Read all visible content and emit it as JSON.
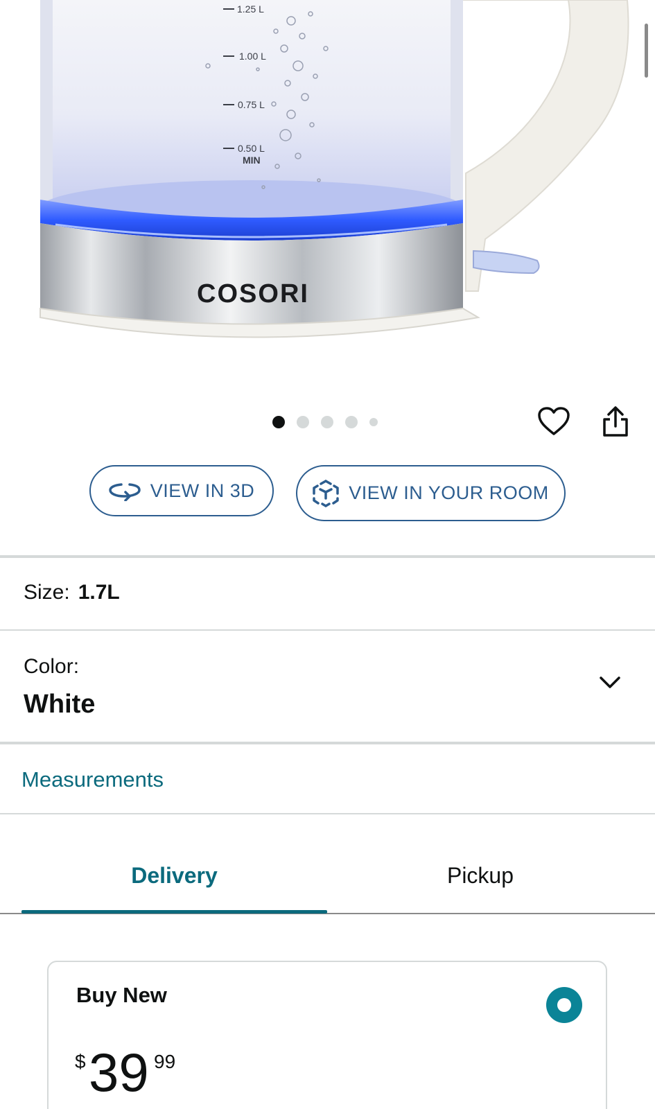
{
  "product_image": {
    "brand": "COSORI",
    "gauge_marks": [
      "1.25 L",
      "1.00 L",
      "0.75 L",
      "0.50 L",
      "MIN"
    ]
  },
  "carousel": {
    "count": 5,
    "active_index": 0
  },
  "actions": {
    "view_3d_label": "VIEW IN 3D",
    "view_room_label": "VIEW IN YOUR ROOM"
  },
  "options": {
    "size_label": "Size:",
    "size_value": "1.7L",
    "color_label": "Color:",
    "color_value": "White"
  },
  "links": {
    "measurements": "Measurements"
  },
  "tabs": [
    {
      "label": "Delivery",
      "selected": true
    },
    {
      "label": "Pickup",
      "selected": false
    }
  ],
  "buy_box": {
    "title": "Buy New",
    "currency_symbol": "$",
    "price_whole": "39",
    "price_fraction": "99",
    "selected": true
  },
  "colors": {
    "link_teal": "#0b6a7d",
    "button_blue": "#2c5d8f",
    "radio_teal": "#0b8497",
    "glow_blue": "#2f5bff"
  },
  "icons": [
    "heart-icon",
    "share-icon",
    "rotate-3d-icon",
    "ar-cube-icon",
    "chevron-down-icon"
  ]
}
